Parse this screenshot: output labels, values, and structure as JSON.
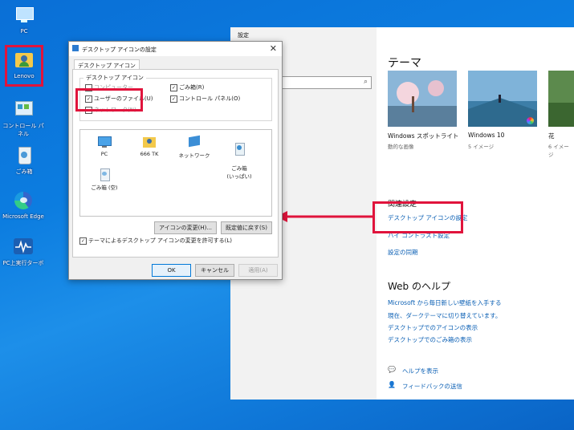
{
  "desktop": {
    "icons": [
      {
        "label": "PC"
      },
      {
        "label": "Lenovo"
      },
      {
        "label": "コントロール パネル"
      },
      {
        "label": "ごみ箱"
      },
      {
        "label": "Microsoft Edge"
      },
      {
        "label": "PC上実行ターボ"
      }
    ]
  },
  "settings": {
    "window_title": "設定",
    "section_title": "テーマ",
    "themes": [
      {
        "name": "Windows スポットライト",
        "sub": "動的な画像"
      },
      {
        "name": "Windows 10",
        "sub": "5 イメージ"
      },
      {
        "name": "花",
        "sub": "6 イメージ"
      }
    ],
    "related_title": "関連設定",
    "related_links": [
      "デスクトップ アイコンの設定",
      "ハイ コントラスト設定",
      "設定の同期"
    ],
    "web_help_title": "Web のヘルプ",
    "web_help_links": [
      "Microsoft から毎日新しい壁紙を入手する",
      "現在、ダークテーマに切り替えています。",
      "デスクトップでのアイコンの表示",
      "デスクトップでのごみ箱の表示"
    ],
    "help_label": "ヘルプを表示",
    "feedback_label": "フィードバックの送信"
  },
  "dialog": {
    "title": "デスクトップ アイコンの設定",
    "tab": "デスクトップ アイコン",
    "group_label": "デスクトップ アイコン",
    "checkboxes": [
      {
        "label": "コンピューター",
        "checked": false
      },
      {
        "label": "ごみ箱(R)",
        "checked": true
      },
      {
        "label": "ユーザーのファイル(U)",
        "checked": true
      },
      {
        "label": "コントロール パネル(O)",
        "checked": true
      },
      {
        "label": "ネットワーク(N)",
        "checked": false
      }
    ],
    "list_icons": [
      {
        "label": "PC"
      },
      {
        "label": "666 TK"
      },
      {
        "label": "ネットワーク"
      },
      {
        "label": "ごみ箱\n(いっぱい)"
      },
      {
        "label": "ごみ箱 (空)"
      }
    ],
    "change_icon_label": "アイコンの変更(H)...",
    "restore_default_label": "既定値に戻す(S)",
    "allow_themes_label": "テーマによるデスクトップ アイコンの変更を許可する(L)",
    "allow_themes_checked": true,
    "ok_label": "OK",
    "cancel_label": "キャンセル",
    "apply_label": "適用(A)"
  },
  "colors": {
    "highlight": "#e0143c",
    "link": "#0a5fb4",
    "desktop": "#0c7de0"
  }
}
